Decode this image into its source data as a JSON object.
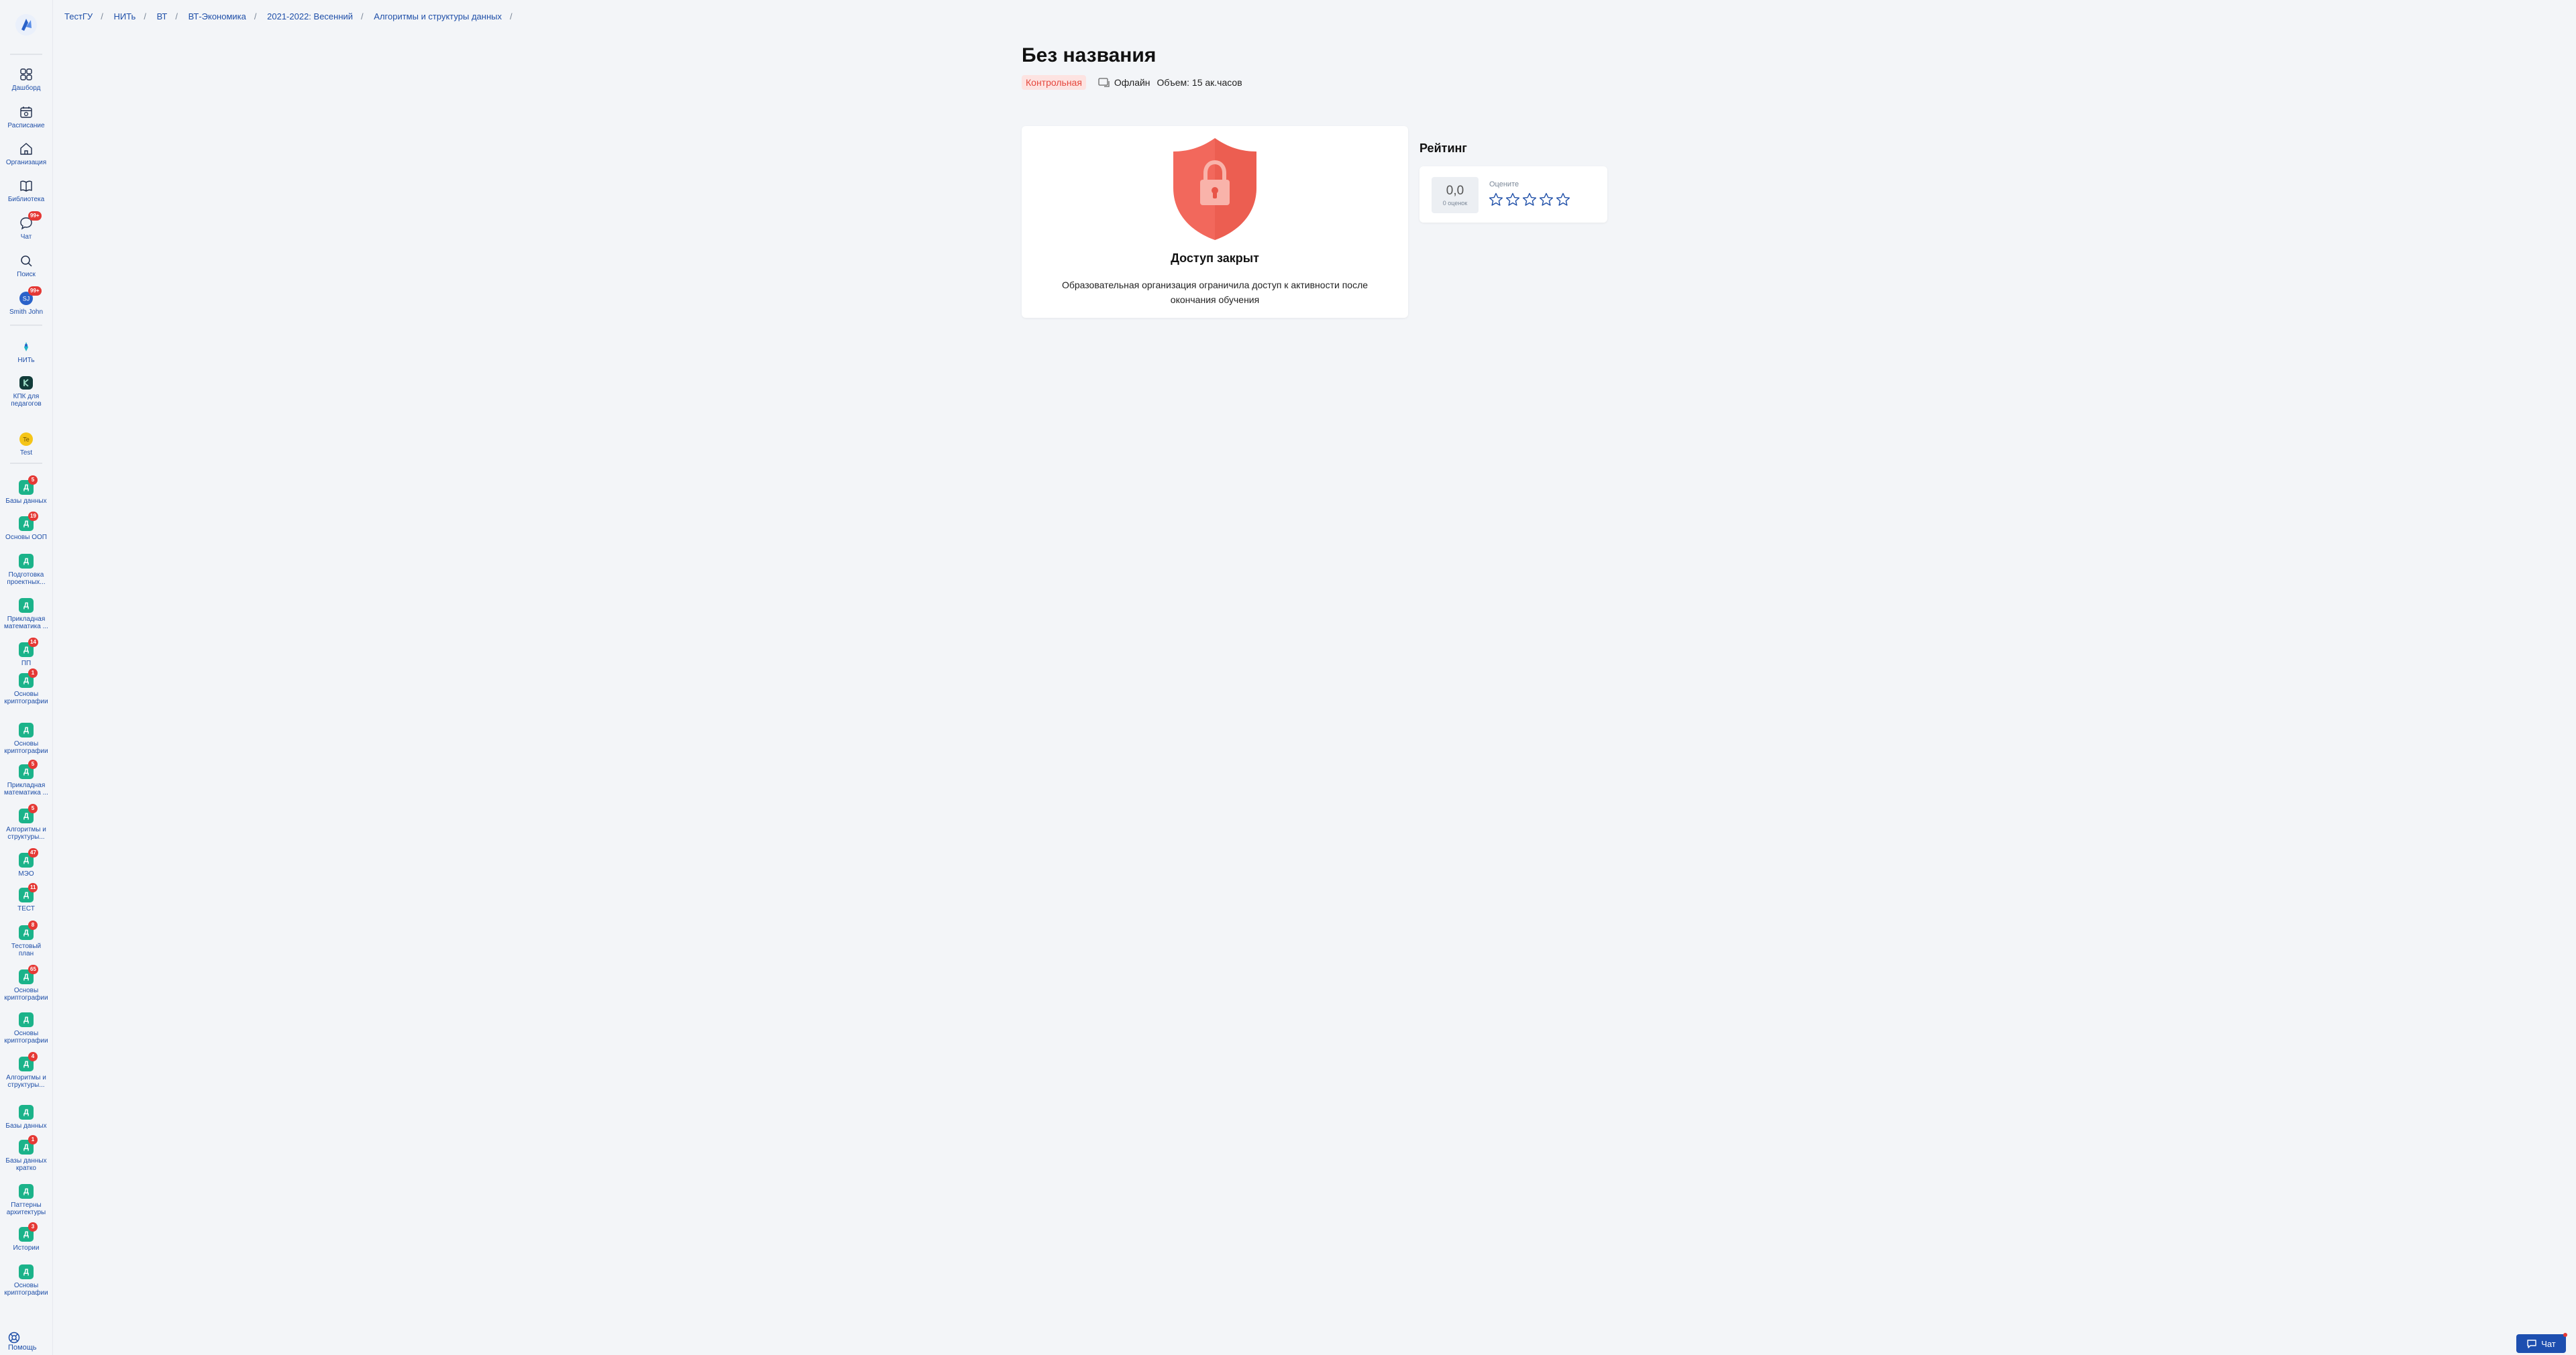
{
  "breadcrumb": [
    "ТестГУ",
    "НИТь",
    "ВТ",
    "ВТ-Экономика",
    "2021-2022: Весенний",
    "Алгоритмы и структуры данных"
  ],
  "sidebar": {
    "main_items": [
      {
        "label": "Дашборд",
        "icon": "dashboard-icon"
      },
      {
        "label": "Расписание",
        "icon": "calendar-icon"
      },
      {
        "label": "Организация",
        "icon": "home-icon"
      },
      {
        "label": "Библиотека",
        "icon": "book-icon"
      },
      {
        "label": "Чат",
        "icon": "chat-icon",
        "badge": "99+"
      },
      {
        "label": "Поиск",
        "icon": "search-icon"
      },
      {
        "label": "Smith John",
        "icon": "avatar",
        "badge": "99+"
      }
    ],
    "org_items": [
      {
        "label": "НИТь",
        "icon": "org-logo-icon"
      },
      {
        "label": "КПК для\nпедагогов",
        "icon": "kpk-logo-icon"
      },
      {
        "label": "Test",
        "icon": "test-logo-icon"
      }
    ],
    "courses": [
      {
        "label": "Базы данных",
        "badge": "5"
      },
      {
        "label": "Основы ООП",
        "badge": "19"
      },
      {
        "label": "Подготовка\nпроектных...",
        "badge": ""
      },
      {
        "label": "Прикладная\nматематика ...",
        "badge": ""
      },
      {
        "label": "ПП",
        "badge": "14"
      },
      {
        "label": "Основы\nкриптографии",
        "badge": "1"
      },
      {
        "label": "Основы\nкриптографии",
        "badge": ""
      },
      {
        "label": "Прикладная\nматематика ...",
        "badge": "5"
      },
      {
        "label": "Алгоритмы и\nструктуры...",
        "badge": "5"
      },
      {
        "label": "МЭО",
        "badge": "47"
      },
      {
        "label": "ТЕСТ",
        "badge": "11"
      },
      {
        "label": "Тестовый\nплан",
        "badge": "8"
      },
      {
        "label": "Основы\nкриптографии",
        "badge": "65"
      },
      {
        "label": "Основы\nкриптографии",
        "badge": ""
      },
      {
        "label": "Алгоритмы и\nструктуры...",
        "badge": "4"
      },
      {
        "label": "Базы данных",
        "badge": ""
      },
      {
        "label": "Базы данных\nкратко",
        "badge": "1"
      },
      {
        "label": "Паттерны\nархитектуры",
        "badge": ""
      },
      {
        "label": "Истории",
        "badge": "3"
      },
      {
        "label": "Основы\nкриптографии",
        "badge": ""
      }
    ],
    "help_label": "Помощь"
  },
  "page": {
    "title": "Без названия",
    "tag": "Контрольная",
    "mode": "Офлайн",
    "volume": "Объем: 15 ак.часов"
  },
  "locked": {
    "title": "Доступ закрыт",
    "text": "Образовательная организация ограничила доступ к активности после окончания обучения"
  },
  "rating": {
    "title": "Рейтинг",
    "score": "0,0",
    "count": "0 оценок",
    "rate_label": "Оцените",
    "stars_total": 5
  },
  "chat_button": "Чат",
  "colors": {
    "accent": "#1f4fa8",
    "tag_red": "#e5483d",
    "course_green": "#1bb38a",
    "shield": "#f2685c"
  }
}
